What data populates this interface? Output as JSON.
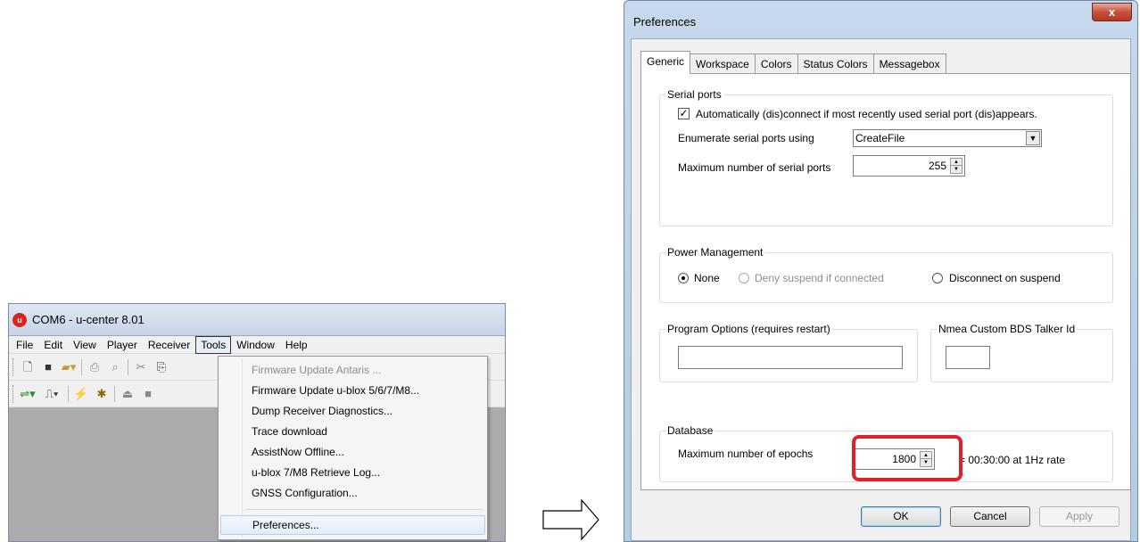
{
  "ucenter": {
    "title": "COM6 - u-center 8.01",
    "logo_letter": "u",
    "menu": [
      "File",
      "Edit",
      "View",
      "Player",
      "Receiver",
      "Tools",
      "Window",
      "Help"
    ],
    "active_menu": "Tools",
    "tools_menu": {
      "items": [
        {
          "label": "Firmware Update Antaris ...",
          "disabled": true
        },
        {
          "label": "Firmware Update u-blox 5/6/7/M8...",
          "disabled": false
        },
        {
          "label": "Dump Receiver Diagnostics...",
          "disabled": false
        },
        {
          "label": "Trace download",
          "disabled": false
        },
        {
          "label": "AssistNow Offline...",
          "disabled": false
        },
        {
          "label": "u-blox 7/M8 Retrieve Log...",
          "disabled": false
        },
        {
          "label": "GNSS Configuration...",
          "disabled": false
        },
        {
          "label": "Preferences...",
          "disabled": false,
          "highlighted": true
        }
      ]
    },
    "toolbar_icons": [
      "new-icon",
      "save-icon",
      "open-icon",
      "print-icon",
      "print-preview-icon",
      "cut-icon",
      "copy-icon",
      "connect-icon",
      "baudrate-icon",
      "wizard-icon",
      "debug-icon",
      "eject-icon",
      "stop-icon"
    ]
  },
  "prefs": {
    "title": "Preferences",
    "close_glyph": "x",
    "tabs": [
      "Generic",
      "Workspace",
      "Colors",
      "Status Colors",
      "Messagebox"
    ],
    "selected_tab": "Generic",
    "serial": {
      "legend": "Serial ports",
      "auto_label": "Automatically (dis)connect if most recently used serial port (dis)appears.",
      "auto_checked": true,
      "enum_label": "Enumerate serial ports using",
      "enum_value": "CreateFile",
      "max_label": "Maximum number of serial ports",
      "max_value": "255"
    },
    "power": {
      "legend": "Power Management",
      "options": [
        {
          "label": "None",
          "checked": true,
          "disabled": false
        },
        {
          "label": "Deny suspend if connected",
          "checked": false,
          "disabled": true
        },
        {
          "label": "Disconnect on suspend",
          "checked": false,
          "disabled": false
        }
      ]
    },
    "program": {
      "legend": "Program Options (requires restart)",
      "value": ""
    },
    "nmea": {
      "legend": "Nmea Custom BDS Talker Id",
      "value": ""
    },
    "database": {
      "legend": "Database",
      "epochs_label": "Maximum number of epochs",
      "epochs_value": "1800",
      "rate_text": "= 00:30:00 at 1Hz rate"
    },
    "buttons": {
      "ok": "OK",
      "cancel": "Cancel",
      "apply": "Apply"
    }
  },
  "colors": {
    "highlight": "#e0202a",
    "close_button": "#c7503c",
    "logo": "#d9261c"
  }
}
